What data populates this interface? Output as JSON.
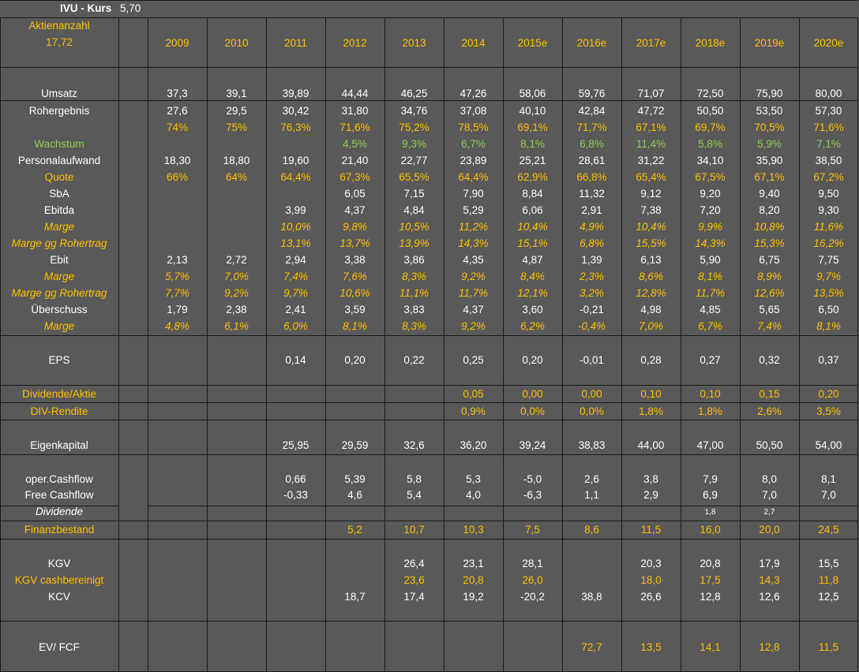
{
  "header": {
    "title": "IVU - Kurs",
    "price": "5,70",
    "shares_label": "Aktienanzahl",
    "shares_value": "17,72"
  },
  "years": [
    "2009",
    "2010",
    "2011",
    "2012",
    "2013",
    "2014",
    "2015e",
    "2016e",
    "2017e",
    "2018e",
    "2019e",
    "2020e"
  ],
  "rows": [
    {
      "label": "Umsatz",
      "style": "white",
      "values": [
        "37,3",
        "39,1",
        "39,89",
        "44,44",
        "46,25",
        "47,26",
        "58,06",
        "59,76",
        "71,07",
        "72,50",
        "75,90",
        "80,00"
      ]
    },
    {
      "label": "Rohergebnis",
      "style": "white",
      "values": [
        "27,6",
        "29,5",
        "30,42",
        "31,80",
        "34,76",
        "37,08",
        "40,10",
        "42,84",
        "47,72",
        "50,50",
        "53,50",
        "57,30"
      ]
    },
    {
      "label": "",
      "style": "yellow",
      "values": [
        "74%",
        "75%",
        "76,3%",
        "71,6%",
        "75,2%",
        "78,5%",
        "69,1%",
        "71,7%",
        "67,1%",
        "69,7%",
        "70,5%",
        "71,6%"
      ]
    },
    {
      "label": "Wachstum",
      "style": "green",
      "values": [
        "",
        "",
        "",
        "4,5%",
        "9,3%",
        "6,7%",
        "8,1%",
        "6,8%",
        "11,4%",
        "5,8%",
        "5,9%",
        "7,1%"
      ]
    },
    {
      "label": "Personalaufwand",
      "style": "white",
      "values": [
        "18,30",
        "18,80",
        "19,60",
        "21,40",
        "22,77",
        "23,89",
        "25,21",
        "28,61",
        "31,22",
        "34,10",
        "35,90",
        "38,50"
      ]
    },
    {
      "label": "Quote",
      "style": "yellow",
      "values": [
        "66%",
        "64%",
        "64,4%",
        "67,3%",
        "65,5%",
        "64,4%",
        "62,9%",
        "66,8%",
        "65,4%",
        "67,5%",
        "67,1%",
        "67,2%"
      ]
    },
    {
      "label": "SbA",
      "style": "white",
      "values": [
        "",
        "",
        "",
        "6,05",
        "7,15",
        "7,90",
        "8,84",
        "11,32",
        "9,12",
        "9,20",
        "9,40",
        "9,50"
      ]
    },
    {
      "label": "Ebitda",
      "style": "white",
      "values": [
        "",
        "",
        "3,99",
        "4,37",
        "4,84",
        "5,29",
        "6,06",
        "2,91",
        "7,38",
        "7,20",
        "8,20",
        "9,30"
      ]
    },
    {
      "label": "Marge",
      "style": "yellow-italic",
      "values": [
        "",
        "",
        "10,0%",
        "9,8%",
        "10,5%",
        "11,2%",
        "10,4%",
        "4,9%",
        "10,4%",
        "9,9%",
        "10,8%",
        "11,6%"
      ]
    },
    {
      "label": "Marge gg Rohertrag",
      "style": "yellow-italic",
      "values": [
        "",
        "",
        "13,1%",
        "13,7%",
        "13,9%",
        "14,3%",
        "15,1%",
        "6,8%",
        "15,5%",
        "14,3%",
        "15,3%",
        "16,2%"
      ]
    },
    {
      "label": "Ebit",
      "style": "white",
      "values": [
        "2,13",
        "2,72",
        "2,94",
        "3,38",
        "3,86",
        "4,35",
        "4,87",
        "1,39",
        "6,13",
        "5,90",
        "6,75",
        "7,75"
      ]
    },
    {
      "label": "Marge",
      "style": "yellow-italic",
      "values": [
        "5,7%",
        "7,0%",
        "7,4%",
        "7,6%",
        "8,3%",
        "9,2%",
        "8,4%",
        "2,3%",
        "8,6%",
        "8,1%",
        "8,9%",
        "9,7%"
      ]
    },
    {
      "label": "Marge gg Rohertrag",
      "style": "yellow-italic",
      "values": [
        "7,7%",
        "9,2%",
        "9,7%",
        "10,6%",
        "11,1%",
        "11,7%",
        "12,1%",
        "3,2%",
        "12,8%",
        "11,7%",
        "12,6%",
        "13,5%"
      ]
    },
    {
      "label": "Überschuss",
      "style": "white",
      "values": [
        "1,79",
        "2,38",
        "2,41",
        "3,59",
        "3,83",
        "4,37",
        "3,60",
        "-0,21",
        "4,98",
        "4,85",
        "5,65",
        "6,50"
      ]
    },
    {
      "label": "Marge",
      "style": "yellow-italic",
      "values": [
        "4,8%",
        "6,1%",
        "6,0%",
        "8,1%",
        "8,3%",
        "9,2%",
        "6,2%",
        "-0,4%",
        "7,0%",
        "6,7%",
        "7,4%",
        "8,1%"
      ]
    },
    {
      "label": "EPS",
      "style": "white",
      "values": [
        "",
        "",
        "0,14",
        "0,20",
        "0,22",
        "0,25",
        "0,20",
        "-0,01",
        "0,28",
        "0,27",
        "0,32",
        "0,37"
      ]
    },
    {
      "label": "Dividende/Aktie",
      "style": "yellow",
      "values": [
        "",
        "",
        "",
        "",
        "",
        "0,05",
        "0,00",
        "0,00",
        "0,10",
        "0,10",
        "0,15",
        "0,20"
      ]
    },
    {
      "label": "DIV-Rendite",
      "style": "yellow",
      "values": [
        "",
        "",
        "",
        "",
        "",
        "0,9%",
        "0,0%",
        "0,0%",
        "1,8%",
        "1,8%",
        "2,6%",
        "3,5%"
      ]
    },
    {
      "label": "Eigenkapital",
      "style": "white",
      "values": [
        "",
        "",
        "25,95",
        "29,59",
        "32,6",
        "36,20",
        "39,24",
        "38,83",
        "44,00",
        "47,00",
        "50,50",
        "54,00"
      ]
    },
    {
      "label": "oper.Cashflow",
      "style": "white",
      "values": [
        "",
        "",
        "0,66",
        "5,39",
        "5,8",
        "5,3",
        "-5,0",
        "2,6",
        "3,8",
        "7,9",
        "8,0",
        "8,1"
      ]
    },
    {
      "label": "Free Cashflow",
      "style": "white",
      "values": [
        "",
        "",
        "-0,33",
        "4,6",
        "5,4",
        "4,0",
        "-6,3",
        "1,1",
        "2,9",
        "6,9",
        "7,0",
        "7,0"
      ]
    },
    {
      "label": "Dividende",
      "style": "white-italic",
      "values": [
        "",
        "",
        "",
        "",
        "",
        "",
        "",
        "",
        "",
        "1,8",
        "2,7",
        ""
      ]
    },
    {
      "label": "Finanzbestand",
      "style": "yellow",
      "values": [
        "",
        "",
        "",
        "5,2",
        "10,7",
        "10,3",
        "7,5",
        "8,6",
        "11,5",
        "16,0",
        "20,0",
        "24,5"
      ]
    },
    {
      "label": "KGV",
      "style": "white",
      "values": [
        "",
        "",
        "",
        "",
        "26,4",
        "23,1",
        "28,1",
        "",
        "20,3",
        "20,8",
        "17,9",
        "15,5"
      ]
    },
    {
      "label": "KGV cashbereinigt",
      "style": "yellow",
      "values": [
        "",
        "",
        "",
        "",
        "23,6",
        "20,8",
        "26,0",
        "",
        "18,0",
        "17,5",
        "14,3",
        "11,8"
      ]
    },
    {
      "label": "KCV",
      "style": "white",
      "values": [
        "",
        "",
        "",
        "18,7",
        "17,4",
        "19,2",
        "-20,2",
        "38,8",
        "26,6",
        "12,8",
        "12,6",
        "12,5"
      ]
    },
    {
      "label": "EV/ FCF",
      "style": "white-yellow",
      "values": [
        "",
        "",
        "",
        "",
        "",
        "",
        "",
        "72,7",
        "13,5",
        "14,1",
        "12,8",
        "11,5"
      ]
    }
  ]
}
